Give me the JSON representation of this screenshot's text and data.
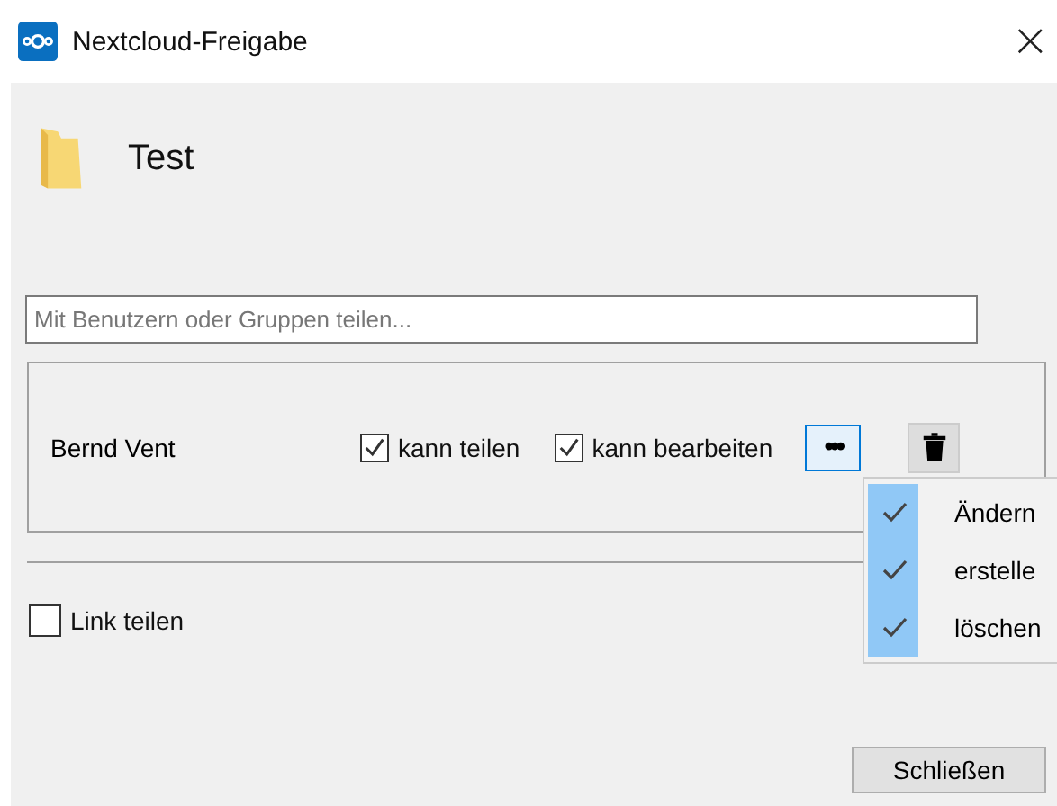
{
  "window": {
    "title": "Nextcloud-Freigabe",
    "close": "×"
  },
  "file": {
    "name": "Test"
  },
  "search": {
    "placeholder": "Mit Benutzern oder Gruppen teilen..."
  },
  "shares": [
    {
      "name": "Bernd Vent",
      "can_share": {
        "label": "kann teilen",
        "checked": true
      },
      "can_edit": {
        "label": "kann bearbeiten",
        "checked": true
      },
      "more": "•••",
      "menu_open": true
    }
  ],
  "menu": [
    {
      "label": "Ändern",
      "checked": true
    },
    {
      "label": "erstelle",
      "checked": true
    },
    {
      "label": "löschen",
      "checked": true
    }
  ],
  "link": {
    "label": "Link teilen",
    "checked": false
  },
  "buttons": [
    "Schließen"
  ]
}
